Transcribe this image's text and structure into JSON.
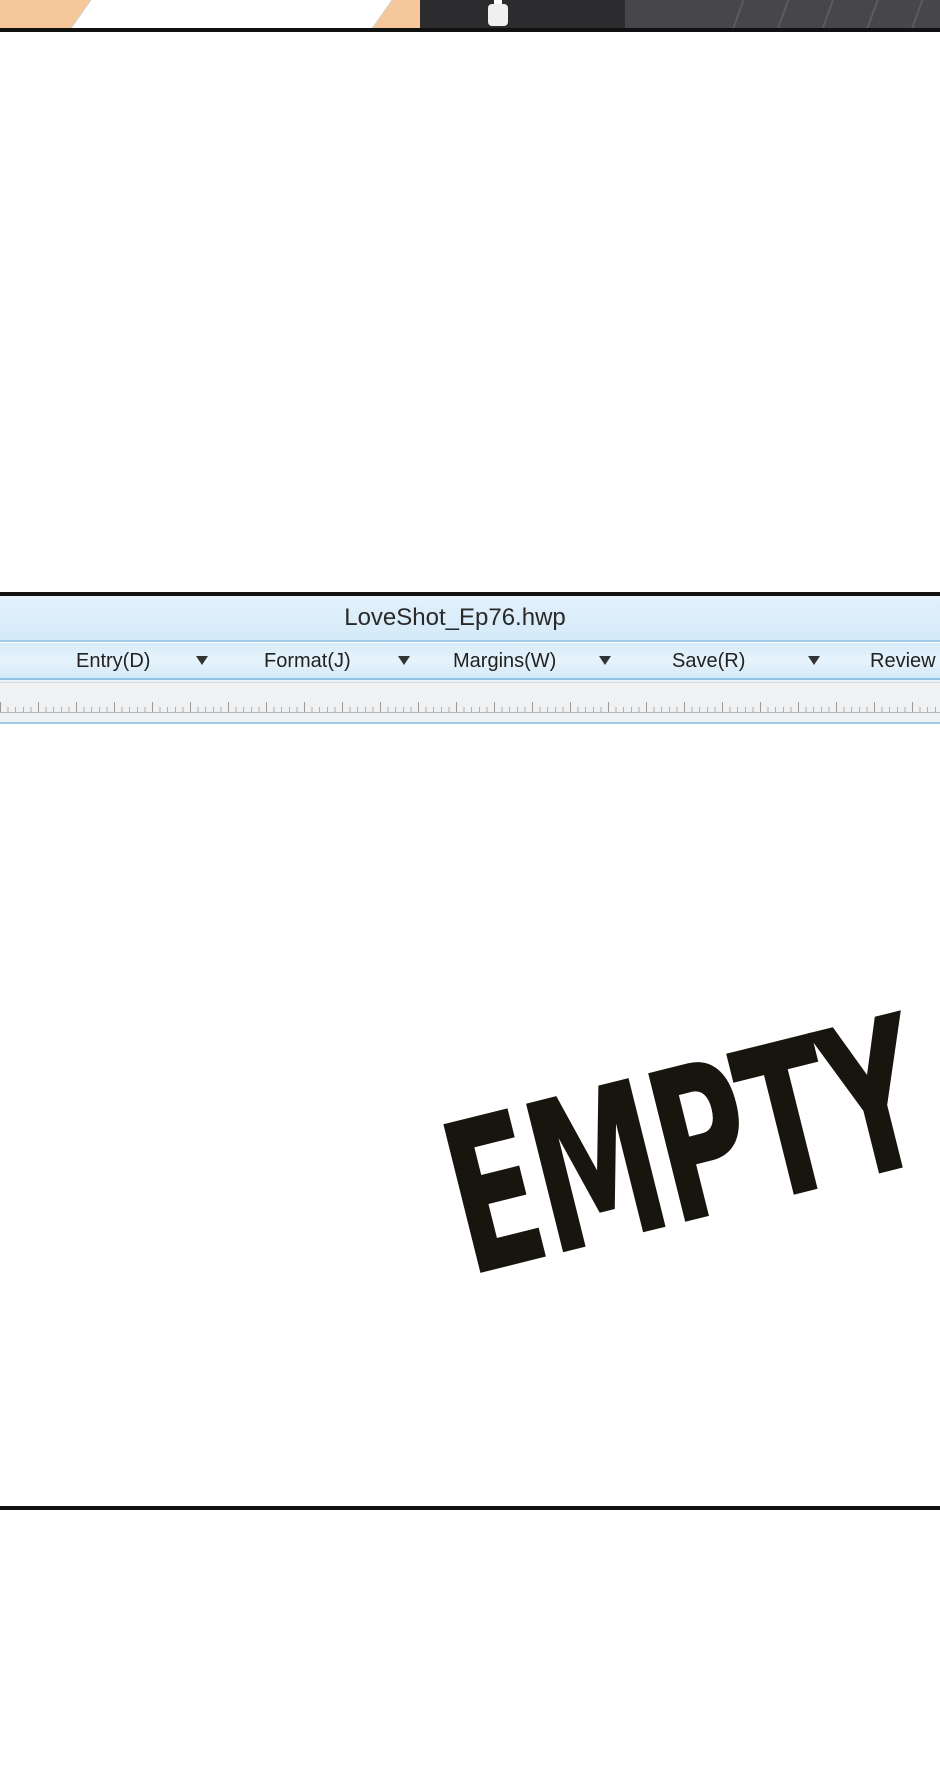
{
  "window": {
    "title": "LoveShot_Ep76.hwp"
  },
  "menu": {
    "items": [
      {
        "label": "Entry(D)"
      },
      {
        "label": "Format(J)"
      },
      {
        "label": "Margins(W)"
      },
      {
        "label": "Save(R)"
      },
      {
        "label": "Review"
      }
    ]
  },
  "document": {
    "caption": "EMPTY"
  },
  "icons": {
    "dropdown": "dropdown-arrow-icon"
  },
  "colors": {
    "titlebar": "#d9edf9",
    "menubar_border": "#8fc2e6",
    "ruler": "#f0f1f2",
    "ink": "#17150e"
  }
}
